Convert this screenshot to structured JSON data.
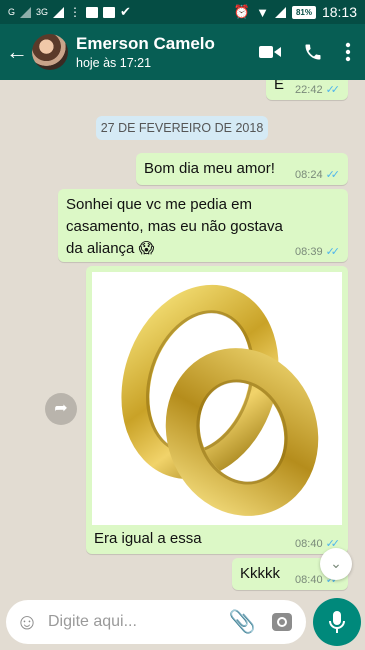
{
  "status_bar": {
    "network_g": "G",
    "network_3g": "3G",
    "battery": "81%",
    "time": "18:13"
  },
  "header": {
    "contact_name": "Emerson Camelo",
    "last_seen": "hoje às 17:21",
    "colors": {
      "bar": "#075e54",
      "status": "#054d44"
    }
  },
  "chat": {
    "partial_message": {
      "text": "E",
      "time": "22:42"
    },
    "date_separator": "27 DE FEVEREIRO DE 2018",
    "messages": [
      {
        "direction": "out",
        "text": "Bom dia meu amor!",
        "time": "08:24"
      },
      {
        "direction": "in",
        "text": "Sonhei que vc me pedia em casamento, mas eu não gostava da aliança 😱",
        "time": "08:39"
      },
      {
        "direction": "in",
        "type": "image",
        "image_subject": "gold-rings",
        "caption": "Era igual a essa",
        "time": "08:40"
      },
      {
        "direction": "out",
        "text": "Kkkkk",
        "time": "08:40"
      }
    ],
    "colors": {
      "bubble": "#dcf8c6",
      "background": "#e2dcd2",
      "read_ticks": "#4fb6ec"
    }
  },
  "composer": {
    "placeholder": "Digite aqui...",
    "colors": {
      "mic_button": "#00897b"
    }
  }
}
